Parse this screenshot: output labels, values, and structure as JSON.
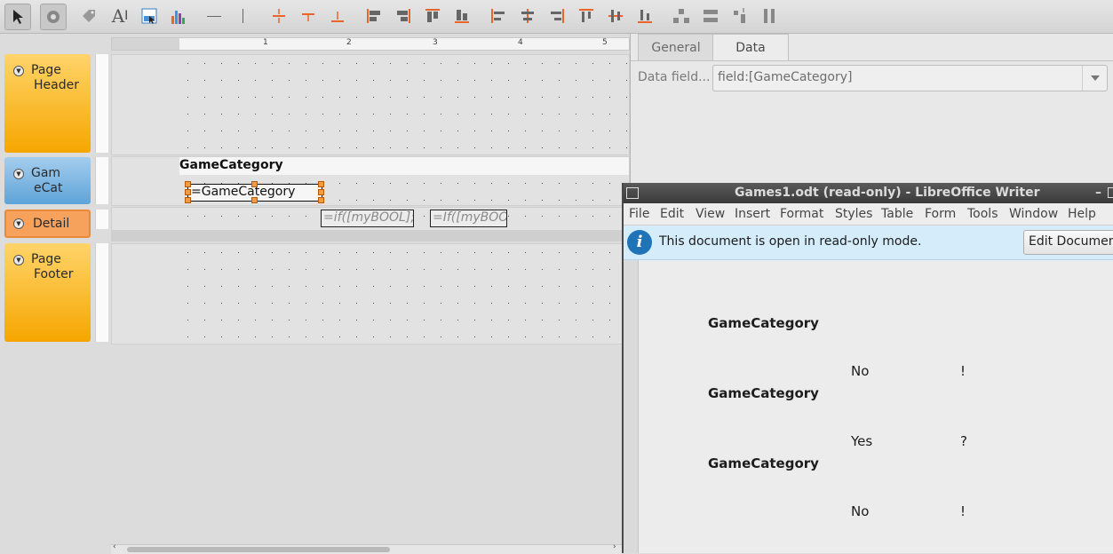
{
  "toolbar": {
    "tools": [
      "select-tool",
      "gear-tool",
      "label-tool",
      "text-tool",
      "image-tool",
      "chart-tool",
      "hline-tool",
      "vline-tool",
      "align-grp"
    ]
  },
  "ruler": {
    "ticks": [
      "1",
      "2",
      "3",
      "4",
      "5"
    ]
  },
  "bands": {
    "page_header": [
      "Page",
      "Header"
    ],
    "group": [
      "Gam",
      "eCat"
    ],
    "detail": "Detail",
    "page_footer": [
      "Page",
      "Footer"
    ]
  },
  "report": {
    "group_title": "GameCategory",
    "group_field": "=GameCategory",
    "detail_field1": "=if([myBOOL];",
    "detail_field2": "=If([myBOO"
  },
  "props": {
    "tabs": [
      "General",
      "Data"
    ],
    "active_tab": "Data",
    "data_field_label": "Data field...",
    "data_field_value": "field:[GameCategory]"
  },
  "writer": {
    "title": "Games1.odt (read-only) - LibreOffice Writer",
    "menu": [
      "File",
      "Edit",
      "View",
      "Insert",
      "Format",
      "Styles",
      "Table",
      "Form",
      "Tools",
      "Window",
      "Help"
    ],
    "info_text": "This document is open in read-only mode.",
    "edit_button": "Edit Document",
    "rows": [
      {
        "category": "GameCategory",
        "value": "No",
        "mark": "!"
      },
      {
        "category": "GameCategory",
        "value": "Yes",
        "mark": "?"
      },
      {
        "category": "GameCategory",
        "value": "No",
        "mark": "!"
      }
    ]
  },
  "colors": {
    "band_yellow": "#f6a600",
    "band_blue": "#5ea4d9",
    "band_orange": "#f6a15c",
    "accent_orange": "#e8662a",
    "info_blue": "#1f74b8"
  }
}
